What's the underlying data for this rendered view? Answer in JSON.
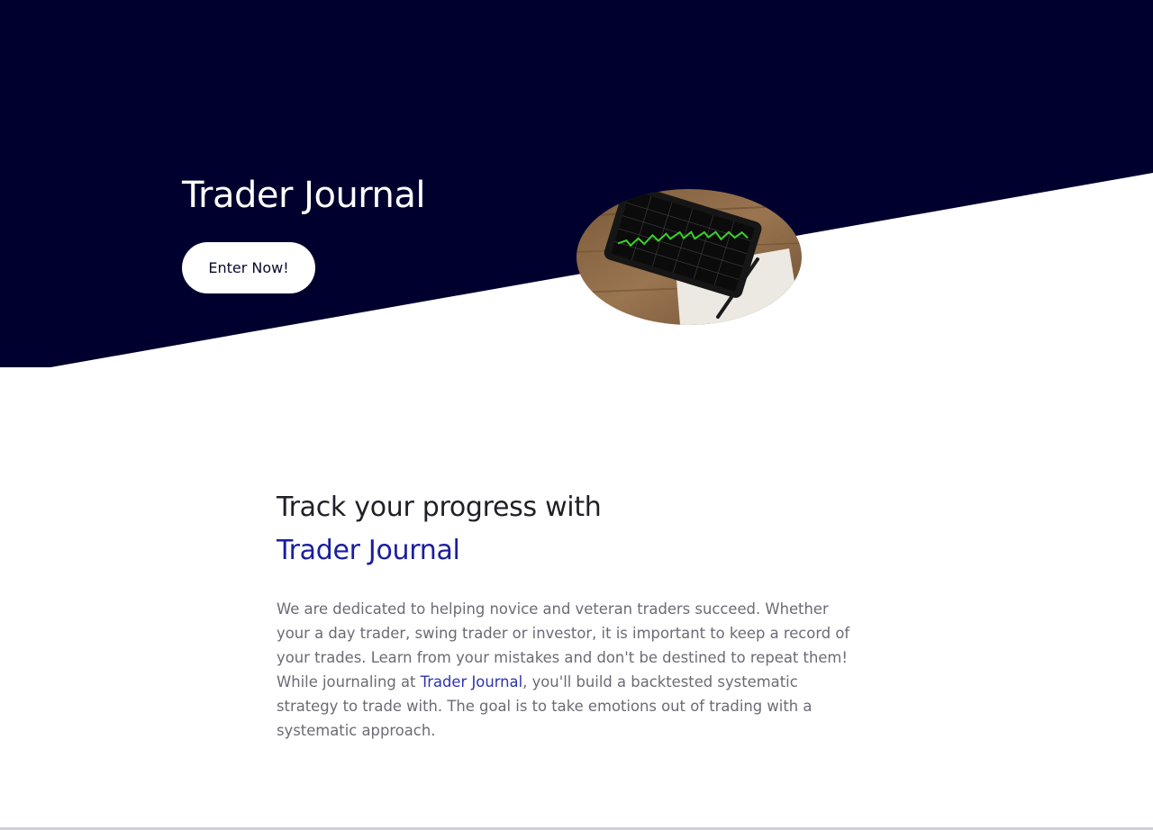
{
  "colors": {
    "hero_background": "#00002f",
    "page_background": "#ffffff",
    "accent_blue": "#1a1e9e",
    "body_text": "#6b6b76"
  },
  "hero": {
    "title": "Trader Journal",
    "cta_label": "Enter Now!",
    "image_icon": "tablet-stock-chart-image"
  },
  "intro": {
    "heading_line1": "Track your progress with",
    "heading_line2": "Trader Journal",
    "paragraph_part1": "We are dedicated to helping novice and veteran traders succeed. Whether your a day trader, swing trader or investor, it is important to keep a record of your trades. Learn from your mistakes and don't be destined to repeat them! While journaling at ",
    "paragraph_link": "Trader Journal",
    "paragraph_part2": ", you'll build a backtested systematic strategy to trade with. The goal is to take emotions out of trading with a systematic approach."
  }
}
